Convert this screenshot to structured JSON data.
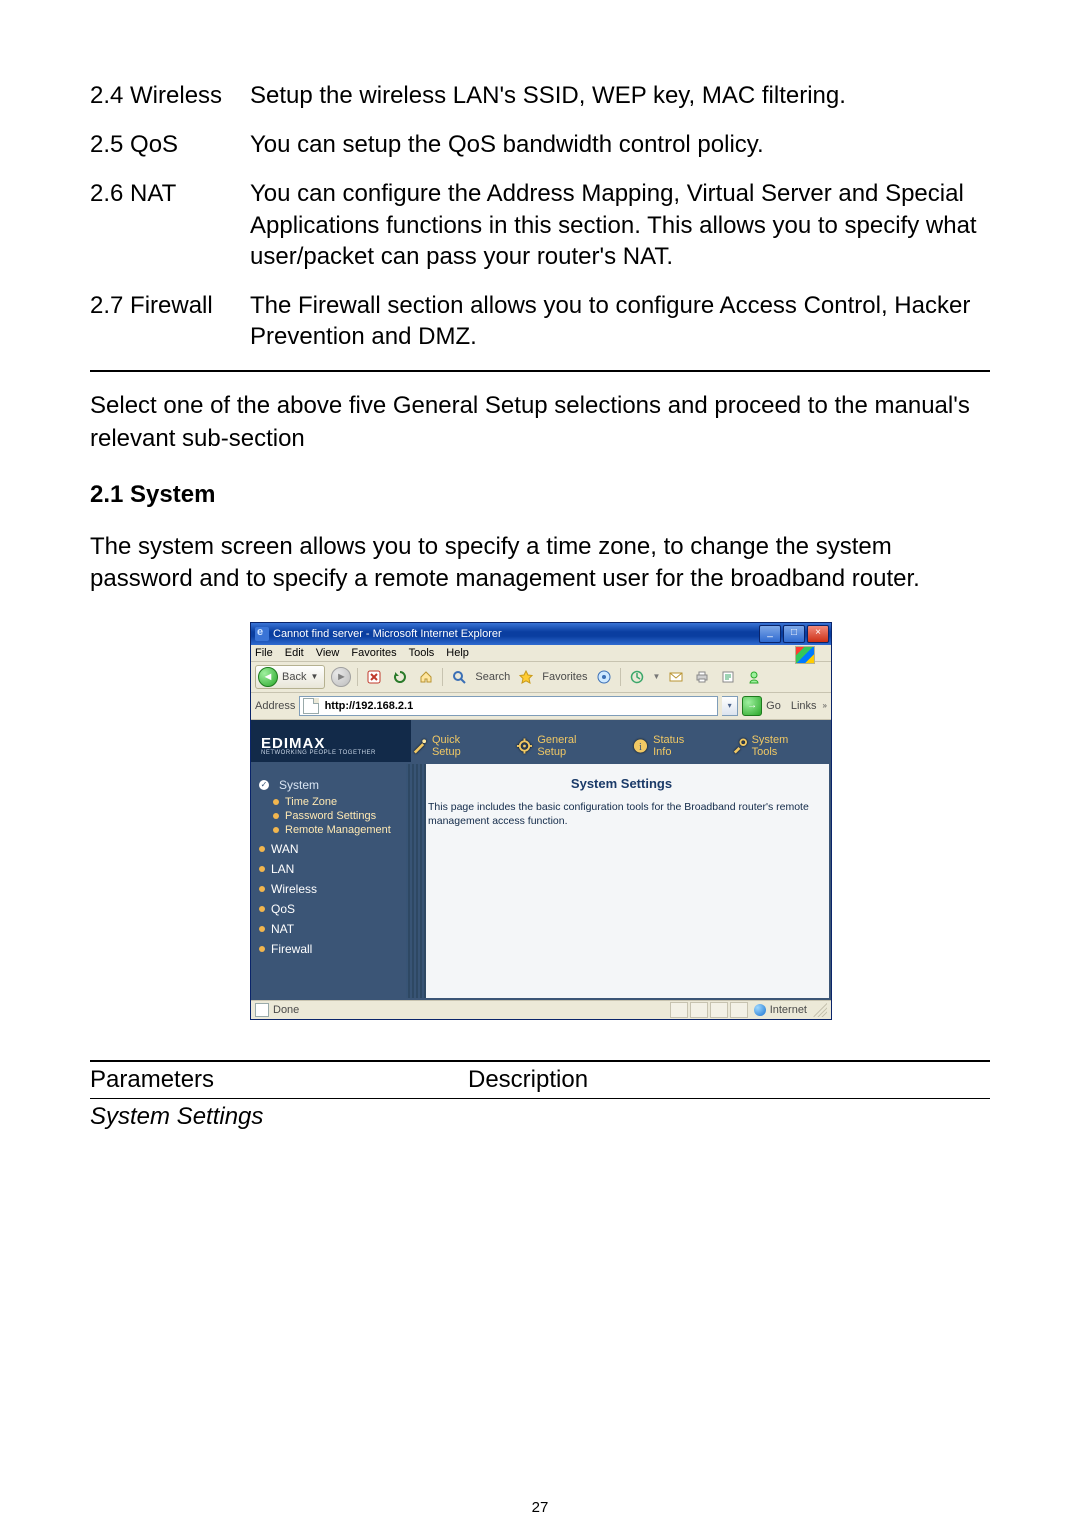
{
  "specs": [
    {
      "key": "2.4 Wireless",
      "val": "Setup the wireless LAN's SSID, WEP key, MAC filtering."
    },
    {
      "key": "2.5 QoS",
      "val": "You can setup the QoS bandwidth control policy."
    },
    {
      "key": "2.6 NAT",
      "val": "You can configure the Address Mapping, Virtual Server and Special Applications functions in this section. This allows you to specify what user/packet can pass your router's NAT."
    },
    {
      "key": "2.7 Firewall",
      "val": "The Firewall section allows you to configure Access Control, Hacker Prevention and DMZ."
    }
  ],
  "select_text": "Select one of the above five General Setup selections and proceed to the manual's relevant sub-section",
  "section_heading": "2.1 System",
  "system_intro": "The system screen allows you to specify a time zone, to change the system password and to specify a remote management user for the broadband router.",
  "ie": {
    "title": "Cannot find server - Microsoft Internet Explorer",
    "menus": [
      "File",
      "Edit",
      "View",
      "Favorites",
      "Tools",
      "Help"
    ],
    "back": "Back",
    "search": "Search",
    "favorites": "Favorites",
    "address_label": "Address",
    "address_value": "http://192.168.2.1",
    "go": "Go",
    "links": "Links",
    "status_done": "Done",
    "status_net": "Internet"
  },
  "router": {
    "brand": "EDIMAX",
    "tagline": "NETWORKING PEOPLE TOGETHER",
    "topnav": [
      "Quick Setup",
      "General Setup",
      "Status Info",
      "System Tools"
    ],
    "sidebar": {
      "system": "System",
      "subs": [
        "Time Zone",
        "Password Settings",
        "Remote Management"
      ],
      "others": [
        "WAN",
        "LAN",
        "Wireless",
        "QoS",
        "NAT",
        "Firewall"
      ]
    },
    "content": {
      "heading": "System Settings",
      "body": "This page includes the basic configuration tools for the Broadband router's remote management access function."
    }
  },
  "param_table": {
    "h1": "Parameters",
    "h2": "Description",
    "group": "System Settings"
  },
  "page_number": "27"
}
